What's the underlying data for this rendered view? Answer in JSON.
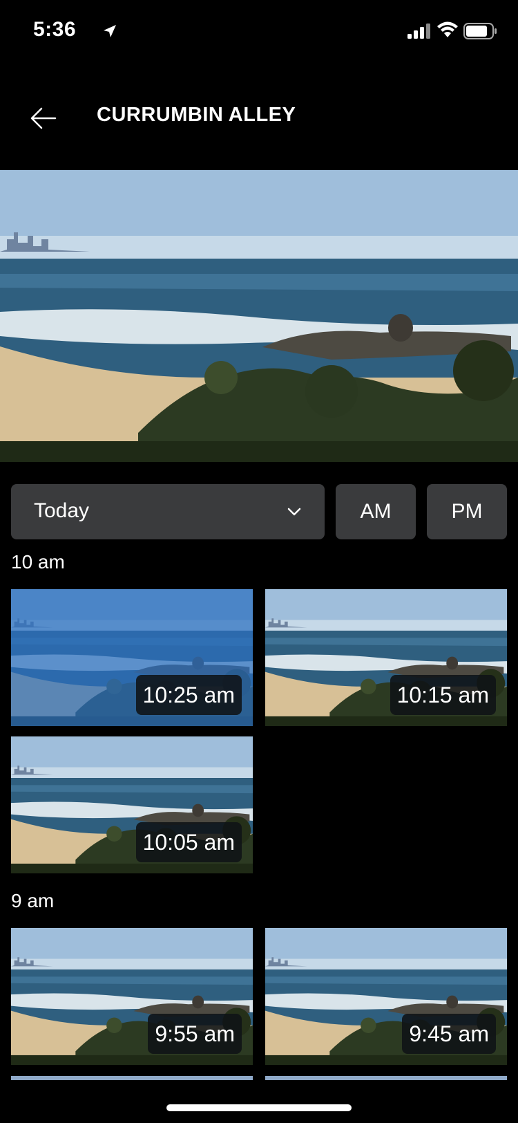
{
  "status_bar": {
    "time": "5:36"
  },
  "header": {
    "title": "CURRUMBIN ALLEY"
  },
  "controls": {
    "day": "Today",
    "am_label": "AM",
    "pm_label": "PM"
  },
  "sections": [
    {
      "label": "10 am",
      "times": [
        "10:25 am",
        "10:15 am",
        "10:05 am"
      ]
    },
    {
      "label": "9 am",
      "times": [
        "9:55 am",
        "9:45 am"
      ]
    }
  ],
  "colors": {
    "background": "#000000",
    "button": "#3a3b3d",
    "badge": "#0f1216"
  },
  "icons": [
    "location-arrow-icon",
    "signal-icon",
    "wifi-icon",
    "battery-icon",
    "back-arrow-icon",
    "chevron-down-icon"
  ]
}
